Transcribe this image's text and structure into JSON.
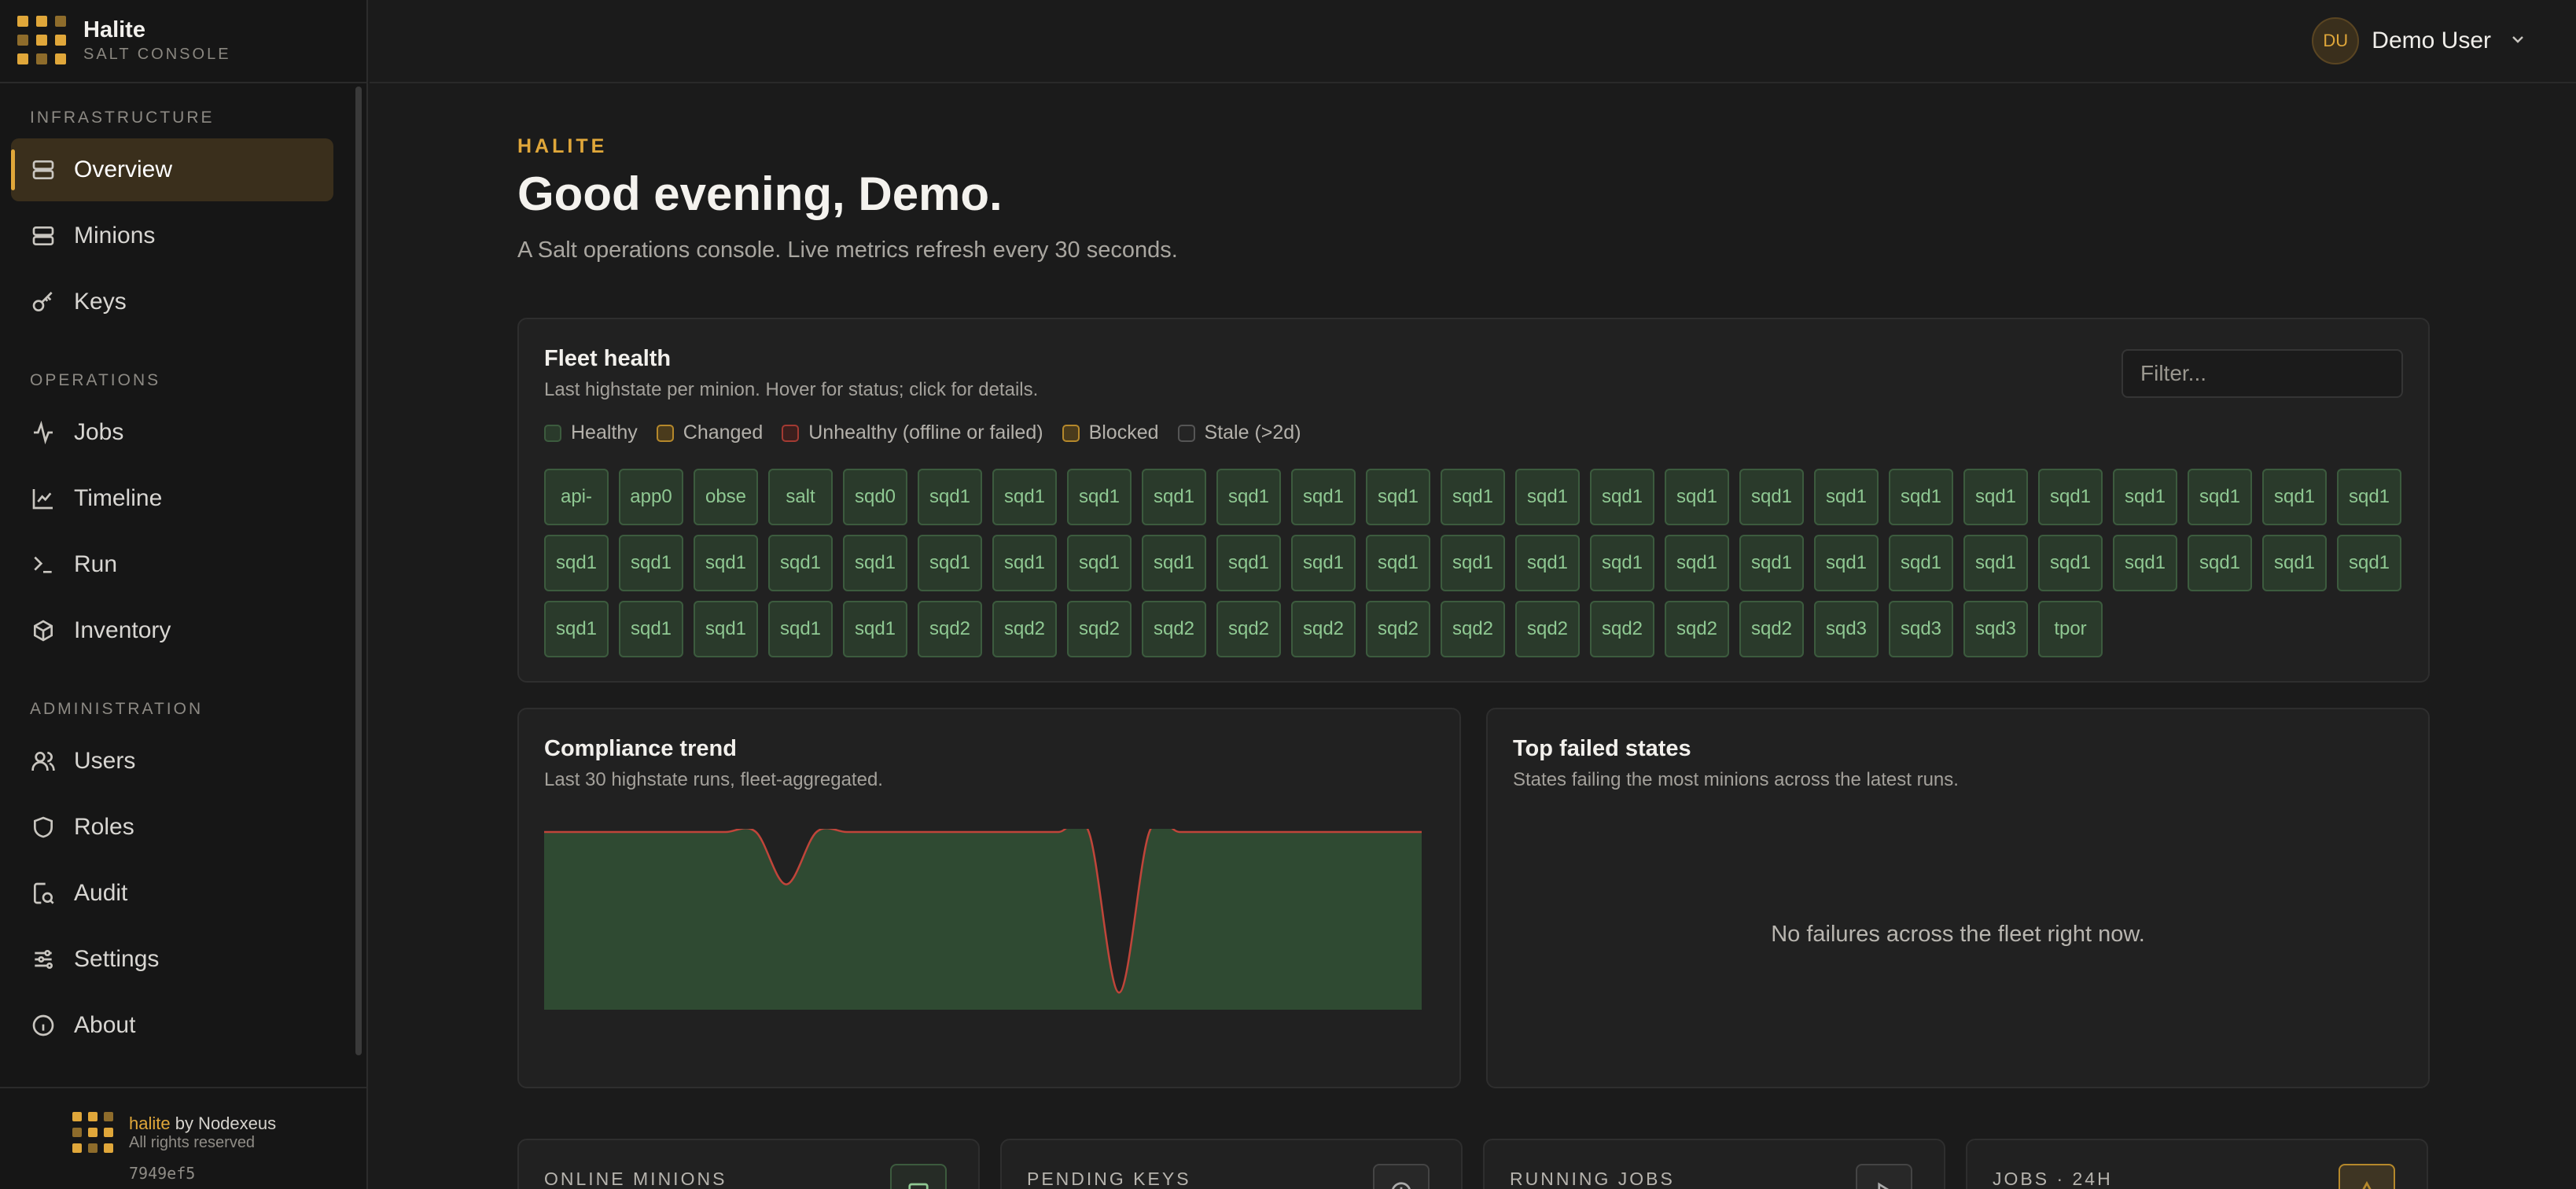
{
  "brand": {
    "name": "Halite",
    "subtitle": "SALT CONSOLE"
  },
  "sidebar": {
    "sections": [
      {
        "title": "INFRASTRUCTURE",
        "items": [
          {
            "label": "Overview",
            "icon": "server-icon",
            "active": true
          },
          {
            "label": "Minions",
            "icon": "server-icon",
            "active": false
          },
          {
            "label": "Keys",
            "icon": "key-icon",
            "active": false
          }
        ]
      },
      {
        "title": "OPERATIONS",
        "items": [
          {
            "label": "Jobs",
            "icon": "activity-icon",
            "active": false
          },
          {
            "label": "Timeline",
            "icon": "chart-line-icon",
            "active": false
          },
          {
            "label": "Run",
            "icon": "terminal-icon",
            "active": false
          },
          {
            "label": "Inventory",
            "icon": "package-icon",
            "active": false
          }
        ]
      },
      {
        "title": "ADMINISTRATION",
        "items": [
          {
            "label": "Users",
            "icon": "users-icon",
            "active": false
          },
          {
            "label": "Roles",
            "icon": "shield-icon",
            "active": false
          },
          {
            "label": "Audit",
            "icon": "file-search-icon",
            "active": false
          },
          {
            "label": "Settings",
            "icon": "sliders-icon",
            "active": false
          },
          {
            "label": "About",
            "icon": "info-icon",
            "active": false
          }
        ]
      }
    ],
    "footer": {
      "product": "halite",
      "by": " by Nodexeus",
      "rights": "All rights reserved",
      "version": "7949ef5"
    }
  },
  "topbar": {
    "avatar_initials": "DU",
    "user_name": "Demo User"
  },
  "main": {
    "kicker": "HALITE",
    "greeting": "Good evening, Demo.",
    "subtitle": "A Salt operations console. Live metrics refresh every 30 seconds."
  },
  "fleet": {
    "title": "Fleet health",
    "subtitle": "Last highstate per minion. Hover for status; click for details.",
    "filter_placeholder": "Filter...",
    "legend": [
      {
        "label": "Healthy",
        "color": "#3c5b3e",
        "fill": "#2a3a2b"
      },
      {
        "label": "Changed",
        "color": "#b5882b",
        "fill": "#4a3b1c"
      },
      {
        "label": "Unhealthy (offline or failed)",
        "color": "#a33a32",
        "fill": "#3b1f1d"
      },
      {
        "label": "Blocked",
        "color": "#b5882b",
        "fill": "#4a3b1c"
      },
      {
        "label": "Stale (>2d)",
        "color": "#555555",
        "fill": "#252525"
      }
    ],
    "minions": [
      "api-",
      "app0",
      "obse",
      "salt",
      "sqd0",
      "sqd1",
      "sqd1",
      "sqd1",
      "sqd1",
      "sqd1",
      "sqd1",
      "sqd1",
      "sqd1",
      "sqd1",
      "sqd1",
      "sqd1",
      "sqd1",
      "sqd1",
      "sqd1",
      "sqd1",
      "sqd1",
      "sqd1",
      "sqd1",
      "sqd1",
      "sqd1",
      "sqd1",
      "sqd1",
      "sqd1",
      "sqd1",
      "sqd1",
      "sqd1",
      "sqd1",
      "sqd1",
      "sqd1",
      "sqd1",
      "sqd1",
      "sqd1",
      "sqd1",
      "sqd1",
      "sqd1",
      "sqd1",
      "sqd1",
      "sqd1",
      "sqd1",
      "sqd1",
      "sqd1",
      "sqd1",
      "sqd1",
      "sqd1",
      "sqd1",
      "sqd1",
      "sqd1",
      "sqd1",
      "sqd1",
      "sqd1",
      "sqd2",
      "sqd2",
      "sqd2",
      "sqd2",
      "sqd2",
      "sqd2",
      "sqd2",
      "sqd2",
      "sqd2",
      "sqd2",
      "sqd2",
      "sqd2",
      "sqd3",
      "sqd3",
      "sqd3",
      "tpor"
    ]
  },
  "compliance": {
    "title": "Compliance trend",
    "subtitle": "Last 30 highstate runs, fleet-aggregated.",
    "series_color": "#c0453a",
    "fill_color": "#2f4a32",
    "values": [
      100,
      100,
      100,
      100,
      100,
      100,
      100,
      100,
      70,
      100,
      100,
      100,
      100,
      100,
      100,
      100,
      100,
      100,
      100,
      8,
      100,
      100,
      100,
      100,
      100,
      100,
      100,
      100,
      100,
      100
    ]
  },
  "failed": {
    "title": "Top failed states",
    "subtitle": "States failing the most minions across the latest runs.",
    "empty_message": "No failures across the fleet right now."
  },
  "stats": [
    {
      "label": "ONLINE MINIONS",
      "icon": "server-icon",
      "accent": "#3c5b3e"
    },
    {
      "label": "PENDING KEYS",
      "icon": "clock-icon",
      "accent": "#444444"
    },
    {
      "label": "RUNNING JOBS",
      "icon": "play-icon",
      "accent": "#444444"
    },
    {
      "label": "JOBS · 24H",
      "icon": "alert-icon",
      "accent": "#b5882b"
    }
  ]
}
